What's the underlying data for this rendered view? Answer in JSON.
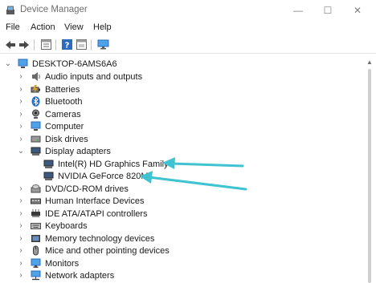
{
  "window": {
    "title": "Device Manager",
    "controls": {
      "minimize": "—",
      "maximize": "☐",
      "close": "✕"
    }
  },
  "menu": [
    "File",
    "Action",
    "View",
    "Help"
  ],
  "toolbar": [
    "back-icon",
    "forward-icon",
    "properties-icon",
    "help-icon",
    "view-icon",
    "monitor-icon"
  ],
  "tree": {
    "root": {
      "label": "DESKTOP-6AMS6A6",
      "icon": "computer-icon",
      "expanded": true
    },
    "items": [
      {
        "label": "Audio inputs and outputs",
        "icon": "speaker-icon",
        "expanded": false
      },
      {
        "label": "Batteries",
        "icon": "battery-icon",
        "expanded": false
      },
      {
        "label": "Bluetooth",
        "icon": "bluetooth-icon",
        "expanded": false
      },
      {
        "label": "Cameras",
        "icon": "camera-icon",
        "expanded": false
      },
      {
        "label": "Computer",
        "icon": "computer-icon",
        "expanded": false
      },
      {
        "label": "Disk drives",
        "icon": "disk-drive-icon",
        "expanded": false
      },
      {
        "label": "Display adapters",
        "icon": "display-adapter-icon",
        "expanded": true,
        "children": [
          {
            "label": "Intel(R) HD Graphics Family",
            "icon": "display-adapter-icon"
          },
          {
            "label": "NVIDIA GeForce 820M",
            "icon": "display-adapter-icon"
          }
        ]
      },
      {
        "label": "DVD/CD-ROM drives",
        "icon": "dvd-drive-icon",
        "expanded": false
      },
      {
        "label": "Human Interface Devices",
        "icon": "hid-icon",
        "expanded": false
      },
      {
        "label": "IDE ATA/ATAPI controllers",
        "icon": "ide-controller-icon",
        "expanded": false
      },
      {
        "label": "Keyboards",
        "icon": "keyboard-icon",
        "expanded": false
      },
      {
        "label": "Memory technology devices",
        "icon": "memory-icon",
        "expanded": false
      },
      {
        "label": "Mice and other pointing devices",
        "icon": "mouse-icon",
        "expanded": false
      },
      {
        "label": "Monitors",
        "icon": "monitor-icon",
        "expanded": false
      },
      {
        "label": "Network adapters",
        "icon": "network-adapter-icon",
        "expanded": false
      }
    ]
  },
  "annotation_color": "#3fc3d0"
}
